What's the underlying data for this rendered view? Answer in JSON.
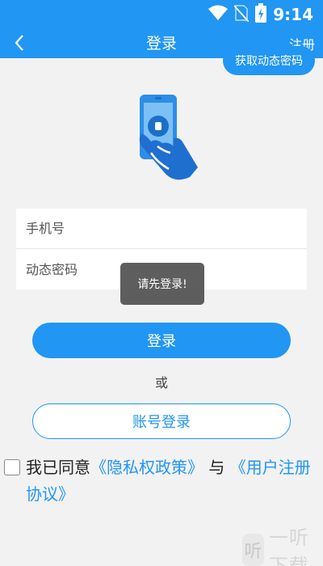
{
  "status_bar": {
    "time": "9:14",
    "icons": [
      "wifi-icon",
      "no-sim-icon",
      "battery-icon"
    ]
  },
  "header": {
    "title": "登录",
    "register_label": "注册",
    "back_icon": "back-arrow-icon"
  },
  "illustration": {
    "icon": "phone-in-hand-icon"
  },
  "form": {
    "phone_placeholder": "手机号",
    "code_placeholder": "动态密码",
    "get_code_label": "获取动态密码"
  },
  "toast": {
    "text": "请先登录!"
  },
  "actions": {
    "login_label": "登录",
    "or_text": "或",
    "account_login_label": "账号登录"
  },
  "agreement": {
    "prefix": "我已同意",
    "privacy_link": "《隐私权政策》",
    "and": "与",
    "user_agreement_link": "《用户注册协议》"
  },
  "watermark": {
    "logo_text": "听",
    "text": "一听下载"
  },
  "colors": {
    "accent": "#2196f3",
    "background": "#f2f2f2",
    "toast": "#505050"
  }
}
